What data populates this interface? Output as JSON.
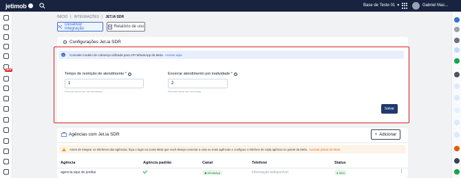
{
  "topbar": {
    "logo_text": "jetimob",
    "base_selector": "Base de Teste 01",
    "user_name": "Gabriel Mac..."
  },
  "sidebar": {
    "new_badge": "NEW"
  },
  "breadcrumb": [
    "INÍCIO",
    "|",
    "INTEGRAÇÕES",
    "|",
    "JET.IA SDR"
  ],
  "actions": {
    "deactivate_label": "Desativar integração",
    "report_label": "Relatório de uso"
  },
  "config": {
    "title": "Configurações Jet.ia SDR",
    "info_text": "Consulte modelo de cobrança utilizada para API WhatsApp da Meta.",
    "info_link": "Acesse aqui.",
    "field1": {
      "label": "Tempo de restrição de atendimento *",
      "value": "1",
      "hint": "Período deve ser em semanas"
    },
    "field2": {
      "label": "Encerrar atendimento por inatividade *",
      "value": "2",
      "hint": "Período deve ser em horas"
    },
    "save_label": "Salvar"
  },
  "agencies": {
    "title": "Agências com Jet.ia SDR",
    "add_label": "Adicionar",
    "warning_text": "Antes de integrar os telefones das agências, faça o login na conta Meta que você deseja conectar a uma ou mais agências e configure o telefone de cada agência no painel da Meta.",
    "warning_link": "Acessar painel da Meta.",
    "columns": [
      "Agência",
      "Agência padrão",
      "Canal",
      "Telefone",
      "Status"
    ],
    "rows": [
      {
        "agency": "agencia aqui de jundiai",
        "channel": "WhatsApp",
        "phone": "Informação indisponível",
        "status": "Ativo"
      }
    ]
  },
  "colors": {
    "topbar": "#17233f",
    "accent": "#3b6fd1",
    "highlight": "#d51f1f",
    "save": "#1e3a6e"
  }
}
